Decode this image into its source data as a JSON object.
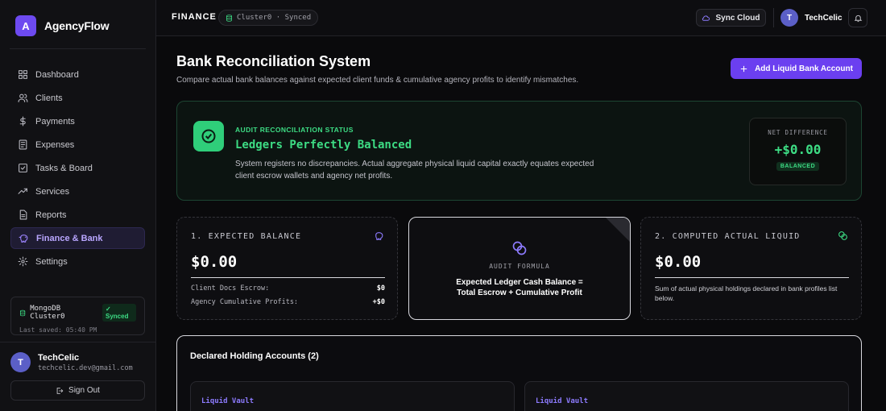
{
  "brand": {
    "logo_letter": "A",
    "name": "AgencyFlow",
    "accent": "#6d4af0"
  },
  "sidebar": {
    "items": [
      {
        "label": "Dashboard",
        "icon": "dashboard-icon"
      },
      {
        "label": "Clients",
        "icon": "users-icon"
      },
      {
        "label": "Payments",
        "icon": "dollar-icon"
      },
      {
        "label": "Expenses",
        "icon": "receipt-icon"
      },
      {
        "label": "Tasks & Board",
        "icon": "checkbox-icon"
      },
      {
        "label": "Services",
        "icon": "trending-icon"
      },
      {
        "label": "Reports",
        "icon": "report-icon"
      },
      {
        "label": "Finance & Bank",
        "icon": "piggy-bank-icon",
        "active": true
      },
      {
        "label": "Settings",
        "icon": "gear-icon"
      }
    ],
    "db": {
      "name": "MongoDB Cluster0",
      "status": "Synced",
      "saved": "Last saved: 05:40 PM"
    },
    "user": {
      "initial": "T",
      "name": "TechCelic",
      "email": "techcelic.dev@gmail.com"
    },
    "signout_label": "Sign Out"
  },
  "topbar": {
    "title": "FINANCE",
    "cluster_pill": "Cluster0 · Synced",
    "sync_label": "Sync Cloud",
    "user_initial": "T",
    "user_name": "TechCelic"
  },
  "page": {
    "title": "Bank Reconciliation System",
    "subtitle": "Compare actual bank balances against expected client funds & cumulative agency profits to identify mismatches.",
    "add_button": "Add Liquid Bank Account"
  },
  "status": {
    "eyebrow": "AUDIT RECONCILIATION STATUS",
    "headline": "Ledgers Perfectly Balanced",
    "description": "System registers no discrepancies. Actual aggregate physical liquid capital exactly equates expected client escrow wallets and agency net profits.",
    "net_label": "NET DIFFERENCE",
    "net_value": "+$0.00",
    "net_badge": "BALANCED",
    "color": "#3ddc84"
  },
  "expected": {
    "heading": "1. EXPECTED BALANCE",
    "value": "$0.00",
    "rows": [
      {
        "label": "Client Docs Escrow:",
        "value": "$0"
      },
      {
        "label": "Agency Cumulative Profits:",
        "value": "+$0"
      }
    ]
  },
  "formula": {
    "label": "AUDIT FORMULA",
    "line1": "Expected Ledger Cash Balance =",
    "line2": "Total Escrow + Cumulative Profit"
  },
  "actual": {
    "heading": "2. COMPUTED ACTUAL LIQUID",
    "value": "$0.00",
    "note": "Sum of actual physical holdings declared in bank profiles list below."
  },
  "holdings": {
    "title": "Declared Holding Accounts (2)",
    "accounts": [
      {
        "label": "Liquid Vault"
      },
      {
        "label": "Liquid Vault"
      }
    ]
  }
}
